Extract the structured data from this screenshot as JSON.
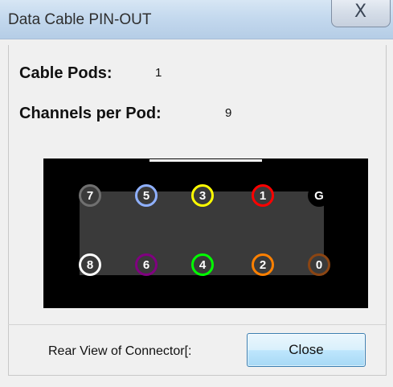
{
  "window": {
    "title": "Data Cable PIN-OUT",
    "close_glyph": "X"
  },
  "info": {
    "cable_pods_label": "Cable Pods:",
    "cable_pods_value": "1",
    "channels_label": "Channels per Pod:",
    "channels_value": "9"
  },
  "pins": {
    "top": [
      {
        "label": "7",
        "color": "#707070"
      },
      {
        "label": "5",
        "color": "#8fb0ff"
      },
      {
        "label": "3",
        "color": "#ffff00"
      },
      {
        "label": "1",
        "color": "#ff0000"
      },
      {
        "label": "G",
        "color": "#000000"
      }
    ],
    "bottom": [
      {
        "label": "8",
        "color": "#ffffff"
      },
      {
        "label": "6",
        "color": "#800080"
      },
      {
        "label": "4",
        "color": "#00ff00"
      },
      {
        "label": "2",
        "color": "#ff8000"
      },
      {
        "label": "0",
        "color": "#8b4513"
      }
    ]
  },
  "footer": {
    "text": "Rear View of Connector[:",
    "close_label": "Close"
  }
}
